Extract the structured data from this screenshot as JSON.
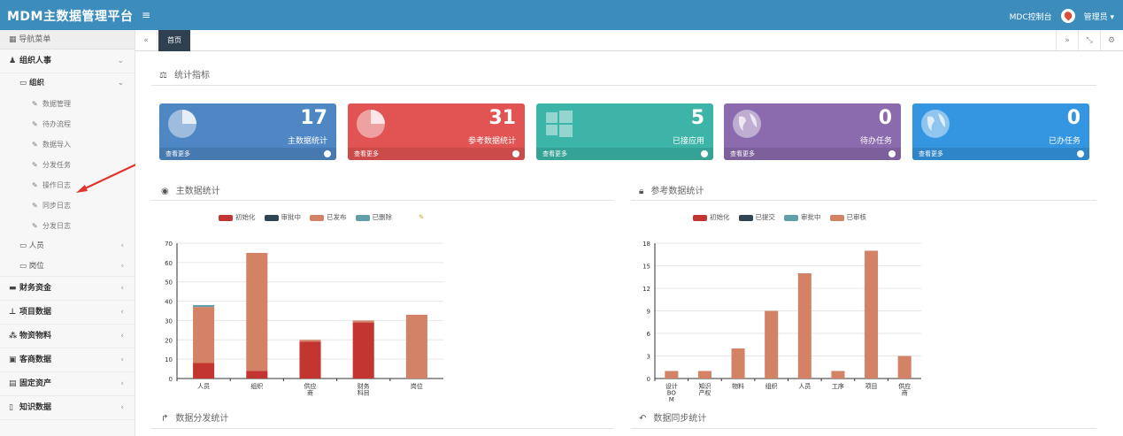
{
  "topbar": {
    "brand": "MDM主数据管理平台",
    "menu_toggle": "≡",
    "console_label": "MDC控制台",
    "user_label": "管理员 ▾"
  },
  "sidebar": {
    "nav_header": "导航菜单",
    "groups": [
      {
        "icon": "users-icon",
        "label": "组织人事",
        "arrow": "⌄"
      },
      {
        "icon": "folder-icon",
        "label": "组织",
        "arrow": "⌄"
      }
    ],
    "leaves": [
      "数据管理",
      "待办流程",
      "数据导入",
      "分发任务",
      "操作日志",
      "同步日志",
      "分发日志"
    ],
    "subs": [
      {
        "label": "人员",
        "arrow": "‹"
      },
      {
        "label": "岗位",
        "arrow": "‹"
      }
    ],
    "menus": [
      {
        "label": "财务资金",
        "arrow": "‹"
      },
      {
        "label": "项目数据",
        "arrow": "‹"
      },
      {
        "label": "物资物料",
        "arrow": "‹"
      },
      {
        "label": "客商数据",
        "arrow": "‹"
      },
      {
        "label": "固定资产",
        "arrow": "‹"
      },
      {
        "label": "知识数据",
        "arrow": "‹"
      }
    ]
  },
  "tabs": {
    "left_nav": "«",
    "home": "首页",
    "right_nav": "»",
    "fullscreen": "⤡",
    "settings": "⚙"
  },
  "sections": {
    "stats": "统计指标",
    "master": "主数据统计",
    "reference": "参考数据统计",
    "distribution": "数据分发统计",
    "sync": "数据同步统计"
  },
  "cards": [
    {
      "value": "17",
      "label": "主数据统计",
      "more": "查看更多",
      "color": "#4f87c4",
      "icon": "pie-chart-icon"
    },
    {
      "value": "31",
      "label": "参考数据统计",
      "more": "查看更多",
      "color": "#e25454",
      "icon": "pie-chart-icon"
    },
    {
      "value": "5",
      "label": "已接应用",
      "more": "查看更多",
      "color": "#3cb5a8",
      "icon": "windows-icon"
    },
    {
      "value": "0",
      "label": "待办任务",
      "more": "查看更多",
      "color": "#8b6aad",
      "icon": "globe-icon"
    },
    {
      "value": "0",
      "label": "已办任务",
      "more": "查看更多",
      "color": "#3496e0",
      "icon": "globe-icon"
    }
  ],
  "chart_data": [
    {
      "type": "bar",
      "stacked": true,
      "categories": [
        "人员",
        "组织",
        "供应商",
        "财务科目",
        "岗位"
      ],
      "series": [
        {
          "name": "初始化",
          "color": "#c23531",
          "values": [
            8,
            4,
            19,
            29,
            0
          ]
        },
        {
          "name": "审批中",
          "color": "#2f4554",
          "values": [
            0,
            0,
            0,
            0,
            0
          ]
        },
        {
          "name": "已发布",
          "color": "#d48265",
          "values": [
            29,
            61,
            1,
            1,
            33
          ]
        },
        {
          "name": "已删除",
          "color": "#61a0a8",
          "values": [
            1,
            0,
            0,
            0,
            0
          ]
        }
      ],
      "ylim": [
        0,
        70
      ],
      "yticks": [
        0,
        10,
        20,
        30,
        40,
        50,
        60,
        70
      ],
      "grid": true,
      "legend": "top-center"
    },
    {
      "type": "bar",
      "stacked": true,
      "categories": [
        "设计BOM",
        "知识产权",
        "物料",
        "组织",
        "人员",
        "工序",
        "项目",
        "供应商"
      ],
      "series": [
        {
          "name": "初始化",
          "color": "#c23531",
          "values": [
            0,
            0,
            0,
            0,
            0,
            0,
            0,
            0
          ]
        },
        {
          "name": "已提交",
          "color": "#2f4554",
          "values": [
            0,
            0,
            0,
            0,
            0,
            0,
            0,
            0
          ]
        },
        {
          "name": "审批中",
          "color": "#61a0a8",
          "values": [
            0,
            0,
            0,
            0,
            0,
            0,
            0,
            0
          ]
        },
        {
          "name": "已审核",
          "color": "#d48265",
          "values": [
            1,
            1,
            4,
            9,
            14,
            1,
            17,
            3
          ]
        }
      ],
      "ylim": [
        0,
        18
      ],
      "yticks": [
        0,
        3,
        6,
        9,
        12,
        15,
        18
      ],
      "grid": true,
      "legend": "top-center"
    }
  ]
}
